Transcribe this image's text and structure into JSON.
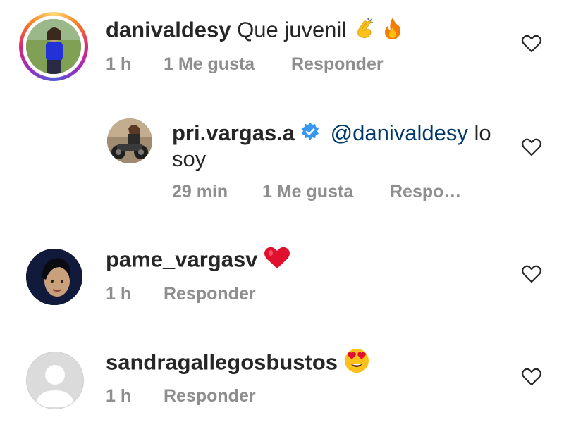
{
  "comments": [
    {
      "username": "danivaldesy",
      "text": "Que juvenil",
      "emojis": [
        "clapping-hands-emoji",
        "fire-emoji"
      ],
      "time": "1 h",
      "likes": "1 Me gusta",
      "reply": "Responder",
      "has_story_ring": true
    },
    {
      "username": "pri.vargas.a",
      "verified": true,
      "mention": "@danivaldesy",
      "text_line1_end": "lo",
      "text_line2": "soy",
      "time": "29 min",
      "likes": "1 Me gusta",
      "reply": "Respo…"
    },
    {
      "username": "pame_vargasv",
      "emojis": [
        "red-heart-emoji"
      ],
      "time": "1 h",
      "reply": "Responder"
    },
    {
      "username": "sandragallegosbustos",
      "emojis": [
        "heart-eyes-emoji"
      ],
      "time": "1 h",
      "reply": "Responder"
    }
  ],
  "colors": {
    "text": "#262626",
    "meta": "#8e8e8e",
    "mention": "#00376b",
    "verified": "#3897f0",
    "heart_emoji": "#e0102e"
  }
}
